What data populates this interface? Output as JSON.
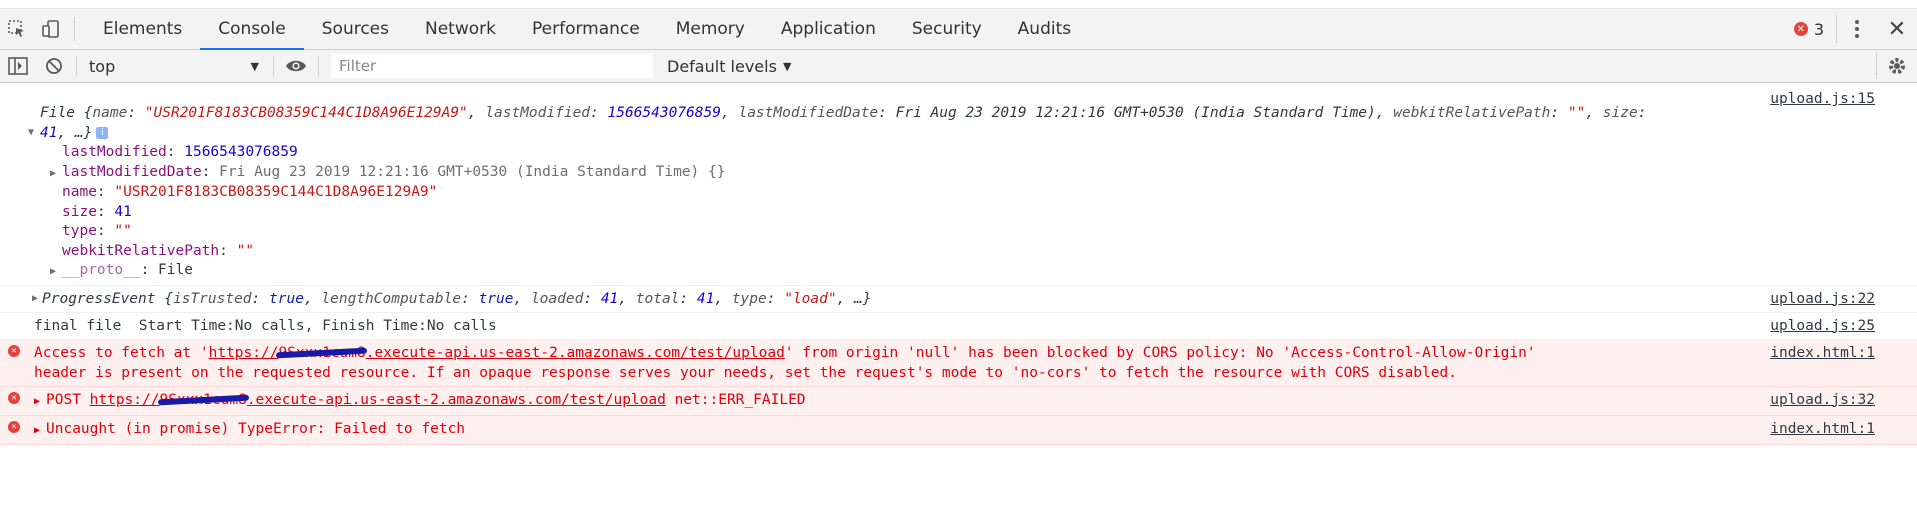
{
  "devtools": {
    "tabs": [
      "Elements",
      "Console",
      "Sources",
      "Network",
      "Performance",
      "Memory",
      "Application",
      "Security",
      "Audits"
    ],
    "error_count": "3"
  },
  "toolbar": {
    "context": "top",
    "filter_placeholder": "Filter",
    "levels": "Default levels"
  },
  "messages": {
    "file": {
      "source": "upload.js:15",
      "summary_prefix": "File ",
      "name_key": "name",
      "name_val": "\"USR201F8183CB08359C144C1D8A96E129A9\"",
      "lm_key": "lastModified",
      "lm_val": "1566543076859",
      "lmd_key": "lastModifiedDate",
      "lmd_val": "Fri Aug 23 2019 12:21:16 GMT+0530 (India Standard Time)",
      "wrp_key": "webkitRelativePath",
      "wrp_val": "\"\"",
      "size_key": "size",
      "size_val": "41",
      "info": "i",
      "props": {
        "lastModified_key": "lastModified",
        "lastModified_val": "1566543076859",
        "lastModifiedDate_key": "lastModifiedDate",
        "lastModifiedDate_val": "Fri Aug 23 2019 12:21:16 GMT+0530 (India Standard Time) {}",
        "name_key": "name",
        "name_val": "\"USR201F8183CB08359C144C1D8A96E129A9\"",
        "size_key": "size",
        "size_val": "41",
        "type_key": "type",
        "type_val": "\"\"",
        "wrp_key": "webkitRelativePath",
        "wrp_val": "\"\"",
        "proto_key": "__proto__",
        "proto_val": "File"
      }
    },
    "progress": {
      "source": "upload.js:22",
      "name": "ProgressEvent",
      "isTrusted_key": "isTrusted",
      "isTrusted_val": "true",
      "lc_key": "lengthComputable",
      "lc_val": "true",
      "loaded_key": "loaded",
      "loaded_val": "41",
      "total_key": "total",
      "total_val": "41",
      "type_key": "type",
      "type_val": "\"load\""
    },
    "final": {
      "source": "upload.js:25",
      "text": "final file  Start Time:No calls, Finish Time:No calls"
    },
    "cors": {
      "source": "index.html:1",
      "pre": "Access to fetch at '",
      "url_start": "https://",
      "url_redacted": "9Sxxx1cum8",
      "url_end": ".execute-api.us-east-2.amazonaws.com/test/upload",
      "line1_post": "' from origin 'null' has been blocked by CORS policy: No 'Access-Control-Allow-Origin'",
      "line2": "header is present on the requested resource. If an opaque response serves your needs, set the request's mode to 'no-cors' to fetch the resource with CORS disabled."
    },
    "post": {
      "source": "upload.js:32",
      "method": "POST",
      "url_start": "https://",
      "url_redacted": "9Sxxx1cum8",
      "url_end": ".execute-api.us-east-2.amazonaws.com/test/upload",
      "status": "net::ERR_FAILED"
    },
    "uncaught": {
      "source": "index.html:1",
      "text": "Uncaught (in promise) TypeError: Failed to fetch"
    }
  },
  "colors": {
    "error_red": "#e0000b",
    "active_tab": "#1a73e8",
    "string": "#c41a16",
    "number": "#1c00cf"
  }
}
